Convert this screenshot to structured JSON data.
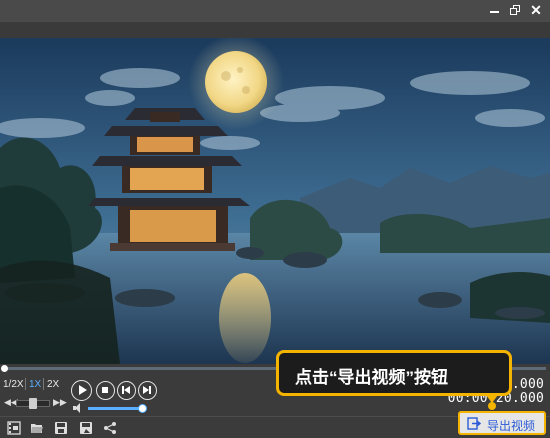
{
  "window": {
    "minimize_label": "",
    "close_glyph": "✕"
  },
  "player": {
    "speeds": [
      "1/2X",
      "1X",
      "2X"
    ],
    "active_speed": "1X",
    "rate_left_glyph": "◀◀",
    "rate_right_glyph": "▶▶",
    "progress_fraction": 0.0,
    "volume_fraction": 0.95,
    "time_current": "00:00:00.000",
    "time_total": "00:00:20.000",
    "time_current_visible": "0.000",
    "time_total_visible": "00:00:20.000"
  },
  "toolbar": {
    "export_label": "导出视频"
  },
  "callout": {
    "text": "点击“导出视频”按钮"
  },
  "colors": {
    "accent": "#5ab0ff",
    "highlight": "#f5b400",
    "export_text": "#2b5bd6"
  },
  "icons": [
    "minimize-icon",
    "maximize-icon",
    "close-icon",
    "play-icon",
    "stop-icon",
    "previous-icon",
    "next-icon",
    "volume-icon",
    "film-add-icon",
    "open-folder-icon",
    "save-icon",
    "save-as-icon",
    "share-icon",
    "export-icon"
  ]
}
